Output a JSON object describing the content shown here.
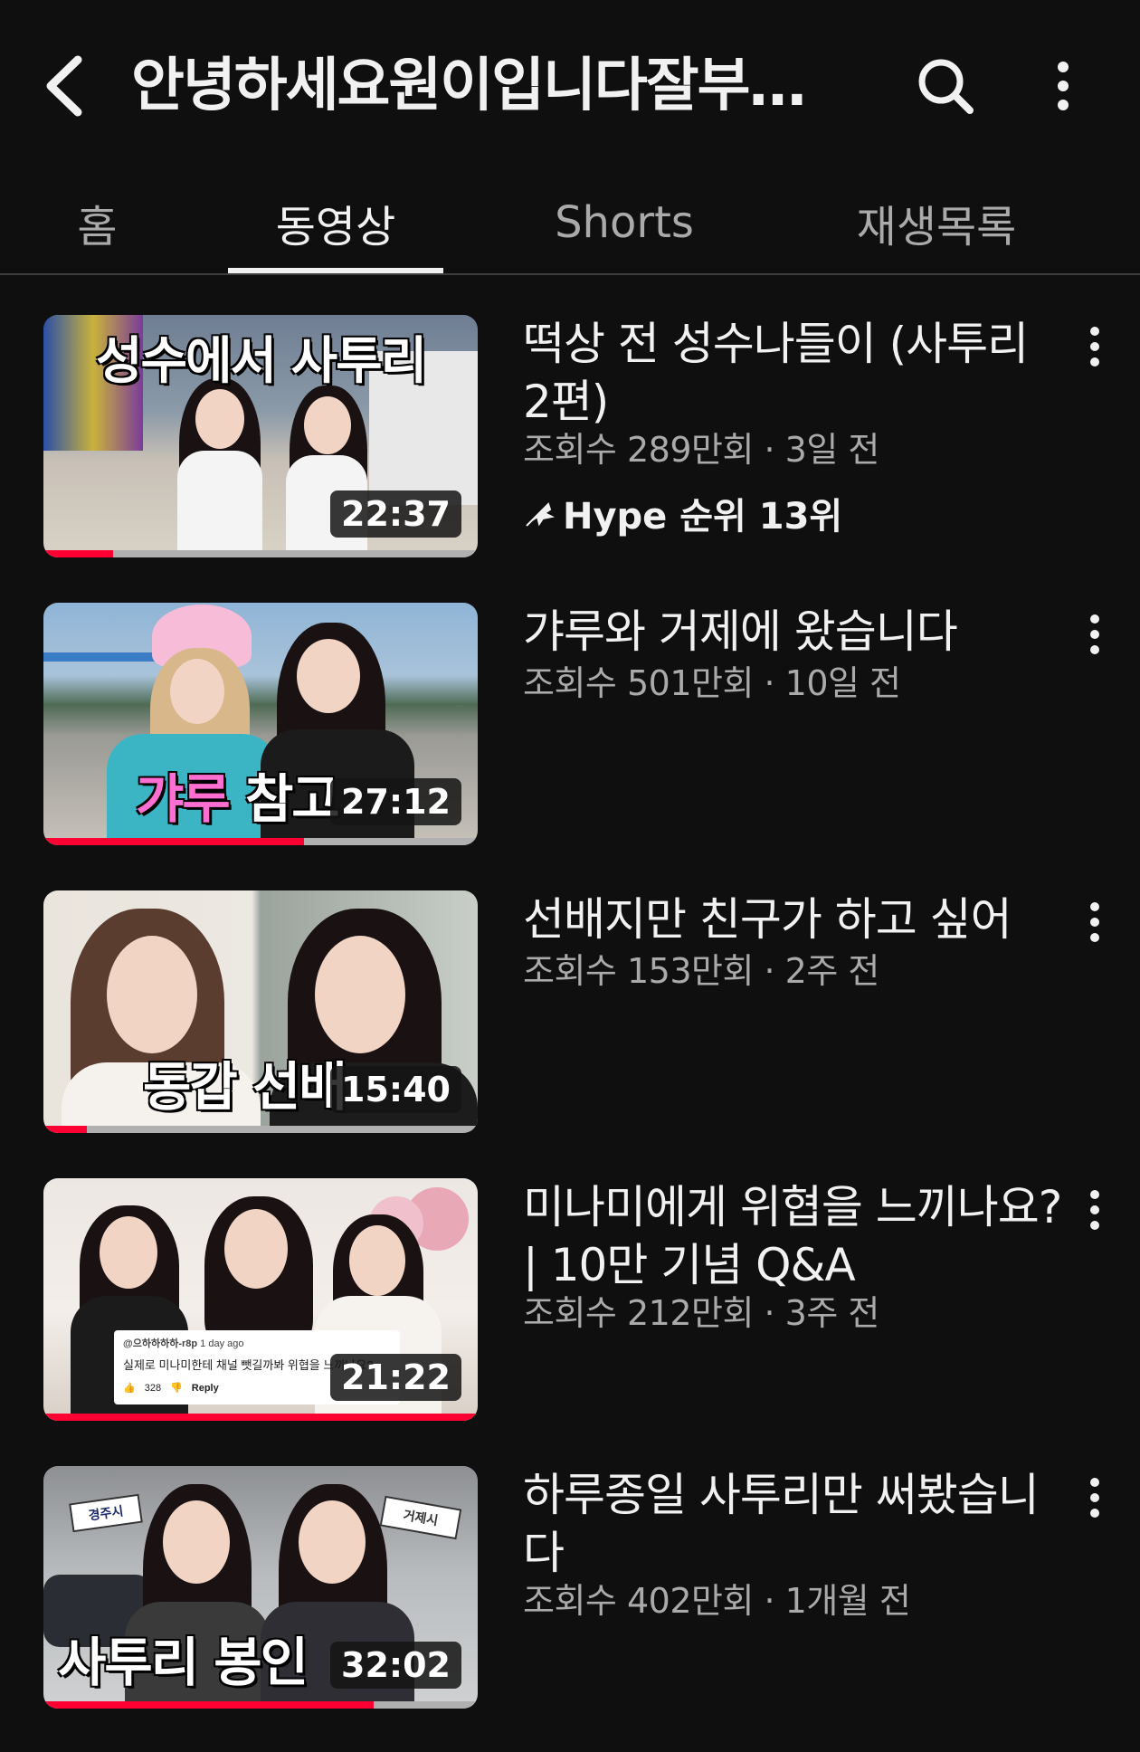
{
  "header": {
    "title": "안녕하세요원이입니다잘부…"
  },
  "tabs": [
    {
      "label": "홈",
      "active": false
    },
    {
      "label": "동영상",
      "active": true
    },
    {
      "label": "Shorts",
      "active": false
    },
    {
      "label": "재생목록",
      "active": false
    }
  ],
  "videos": [
    {
      "title": "떡상 전 성수나들이 (사투리 2편)",
      "views": "조회수 289만회",
      "age": "3일 전",
      "meta": "조회수 289만회 · 3일 전",
      "duration": "22:37",
      "caption": "성수에서 사투리",
      "hype": "Hype 순위 13위",
      "watched_fraction": 0.16
    },
    {
      "title": "갸루와 거제에 왔습니다",
      "views": "조회수 501만회",
      "age": "10일 전",
      "meta": "조회수 501만회 · 10일 전",
      "duration": "27:12",
      "caption_pink": "갸루",
      "caption": "참고",
      "watched_fraction": 0.6
    },
    {
      "title": "선배지만 친구가 하고 싶어",
      "views": "조회수 153만회",
      "age": "2주 전",
      "meta": "조회수 153만회 · 2주 전",
      "duration": "15:40",
      "caption": "동갑 선배",
      "watched_fraction": 0.1
    },
    {
      "title": "미나미에게 위협을 느끼나요? | 10만 기념 Q&A",
      "views": "조회수 212만회",
      "age": "3주 전",
      "meta": "조회수 212만회 · 3주 전",
      "duration": "21:22",
      "comment_user": "@으하하하하-r8p",
      "comment_time": "1 day ago",
      "comment_text": "실제로 미나미한테 채널 뺏길까봐 위협을 느끼나요?",
      "comment_likes": "328",
      "comment_reply": "Reply",
      "watched_fraction": 1.0
    },
    {
      "title": "하루종일 사투리만 써봤습니다",
      "views": "조회수 402만회",
      "age": "1개월 전",
      "meta": "조회수 402만회 · 1개월 전",
      "duration": "32:02",
      "caption": "사투리 봉인",
      "sign_left": "경주시",
      "sign_right": "거제시",
      "watched_fraction": 0.76
    }
  ],
  "colors": {
    "background": "#0f0f0f",
    "text_primary": "#f1f1f1",
    "text_secondary": "#aaaaaa",
    "progress": "#ff0033"
  }
}
